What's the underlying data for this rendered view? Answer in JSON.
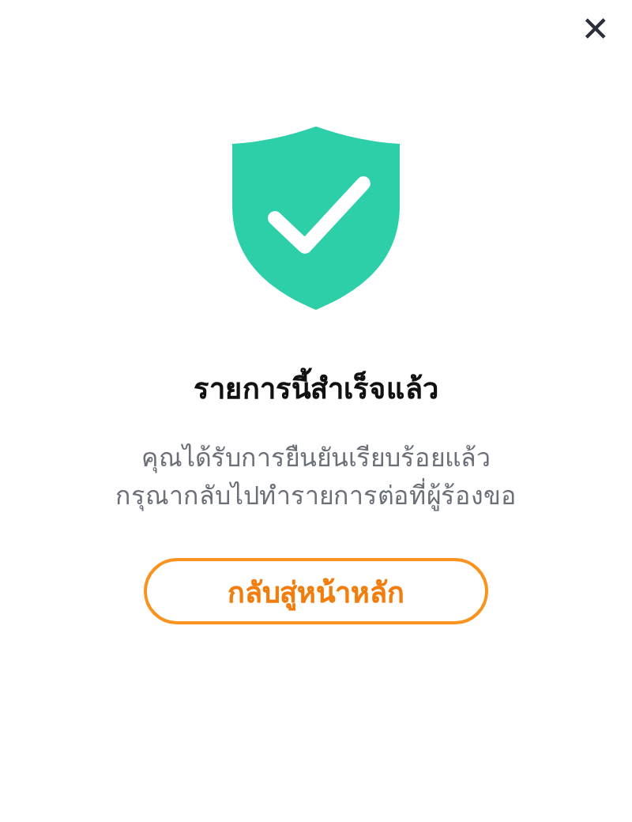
{
  "close_button": {
    "label": "✕"
  },
  "title": "รายการนี้สำเร็จแล้ว",
  "message_lines": [
    "คุณได้รับการยืนยันเรียบร้อยแล้ว",
    "กรุณากลับไปทำรายการต่อที่ผู้ร้องขอ"
  ],
  "button": {
    "label": "กลับสู่หน้าหลัก"
  }
}
